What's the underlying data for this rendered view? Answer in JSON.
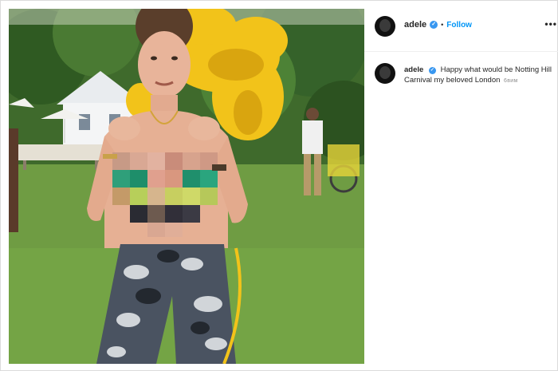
{
  "post": {
    "photo_alt": "Instagram post photo",
    "username": "adele",
    "verified_badge": "✓",
    "separator": "•",
    "follow_label": "Follow",
    "more_label": "•••",
    "caption_text": "Happy what would be Notting Hill Carnival my beloved London",
    "time_ago": "6вим"
  },
  "icons": {
    "avatar": "avatar-icon",
    "verified": "verified-badge-icon",
    "more": "more-options-icon"
  },
  "colors": {
    "accent": "#0095f6",
    "verified": "#3897f0",
    "text": "#262626",
    "muted": "#8e8e8e"
  }
}
